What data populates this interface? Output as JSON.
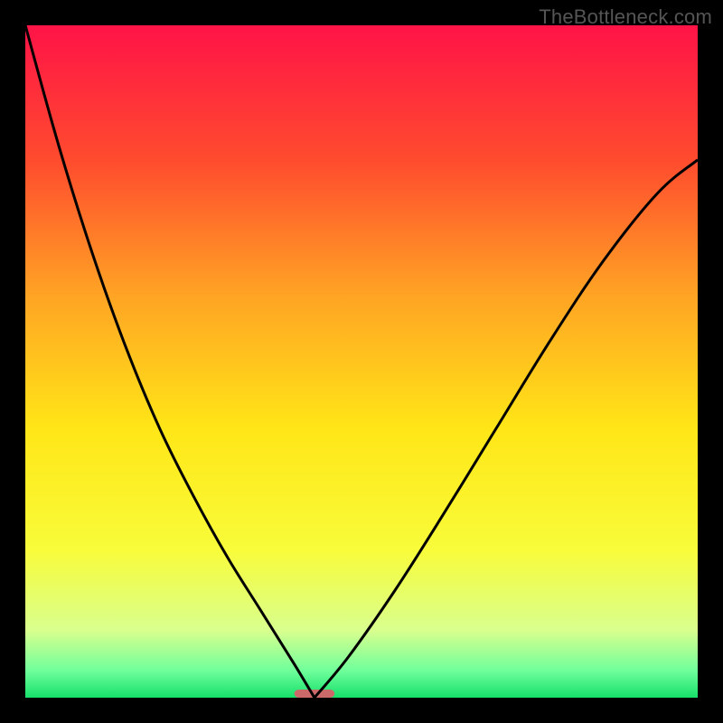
{
  "watermark": "TheBottleneck.com",
  "chart_data": {
    "type": "line",
    "title": "",
    "xlabel": "",
    "ylabel": "",
    "xlim": [
      0,
      100
    ],
    "ylim": [
      0,
      100
    ],
    "grid": false,
    "legend": false,
    "gradient_stops": [
      {
        "offset": 0,
        "color": "#ff1347"
      },
      {
        "offset": 20,
        "color": "#ff4b2e"
      },
      {
        "offset": 40,
        "color": "#ffa324"
      },
      {
        "offset": 60,
        "color": "#ffe617"
      },
      {
        "offset": 78,
        "color": "#f8fc3a"
      },
      {
        "offset": 90,
        "color": "#d9ff8e"
      },
      {
        "offset": 96,
        "color": "#6fff9b"
      },
      {
        "offset": 100,
        "color": "#16e06a"
      }
    ],
    "minimum_marker": {
      "center_pct": 43,
      "width_pct": 6,
      "color": "#cc6a6a"
    },
    "series": [
      {
        "name": "left-branch",
        "x": [
          0,
          5,
          10,
          15,
          20,
          25,
          30,
          35,
          40,
          43
        ],
        "y": [
          100,
          82,
          66,
          52,
          40,
          30,
          21,
          13,
          5,
          0
        ]
      },
      {
        "name": "right-branch",
        "x": [
          43,
          48,
          55,
          62,
          70,
          78,
          86,
          94,
          100
        ],
        "y": [
          0,
          6,
          16,
          27,
          40,
          53,
          65,
          75,
          80
        ]
      }
    ]
  }
}
